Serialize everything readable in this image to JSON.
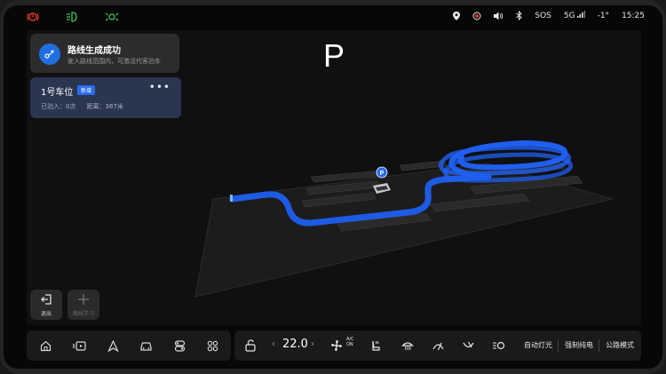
{
  "statusbar": {
    "left_icons": [
      "warning-light-icon",
      "headlight-icon",
      "position-light-icon"
    ],
    "right": {
      "sos_label": "SOS",
      "network_label": "5G",
      "temperature": "-1°",
      "clock": "15:25"
    }
  },
  "route_card": {
    "title": "路线生成成功",
    "subtitle": "驶入路线范围内，可激活代客泊车"
  },
  "parking_card": {
    "title": "1号车位",
    "badge": "新增",
    "parked_label": "已泊入：0次",
    "distance_label": "距离：387米"
  },
  "parking_symbol": "P",
  "map_pin_label": "P",
  "side_buttons": [
    {
      "label": "退出"
    },
    {
      "label": "路线学习"
    }
  ],
  "climate": {
    "temperature": "22.0",
    "ac_label_top": "A/C",
    "ac_label_bottom": "ON",
    "auto_light_label": "自动灯光",
    "force_ev_label": "强制纯电",
    "road_mode_label": "公路模式"
  },
  "colors": {
    "route_blue": "#1f5ff0",
    "accent": "#2a6cf0",
    "warning": "#e53935",
    "light_green": "#3ec35a"
  }
}
